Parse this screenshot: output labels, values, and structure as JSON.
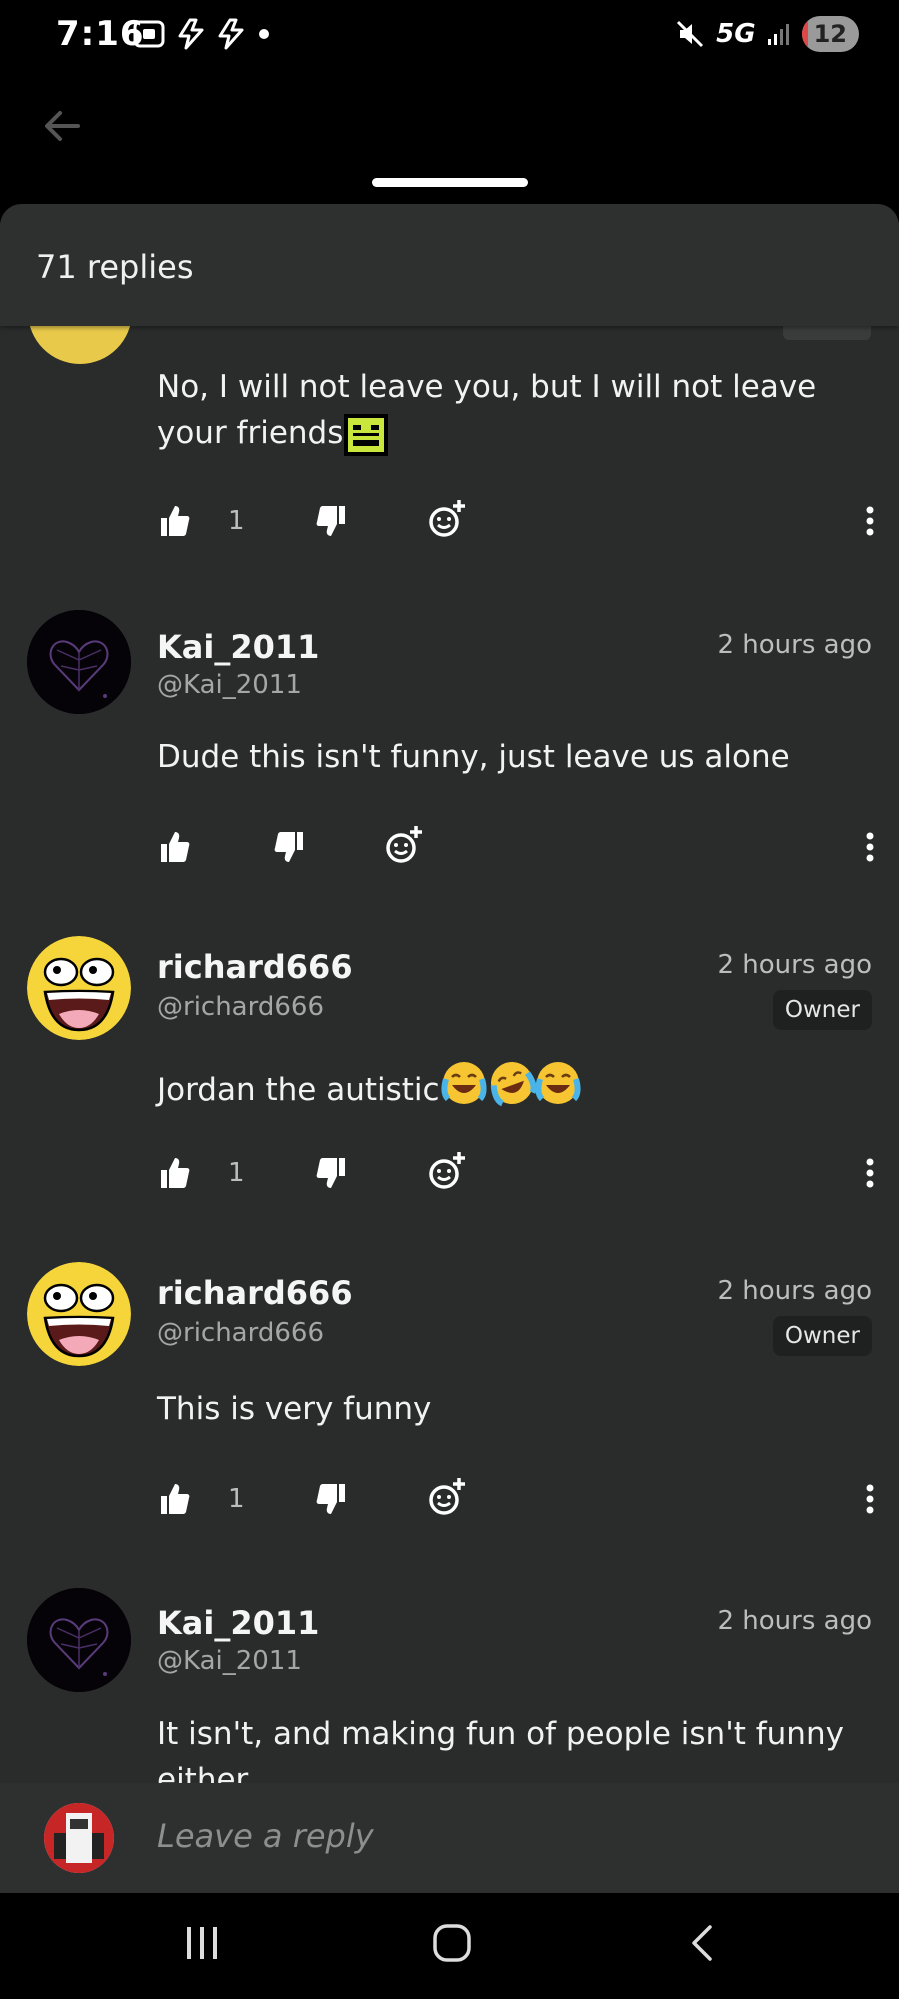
{
  "status_bar": {
    "time": "7:16",
    "battery": "12",
    "battery_level": 0.12,
    "network": "5G",
    "icons": [
      "screenshot-icon",
      "flash-icon",
      "flash-icon",
      "dot-icon",
      "mute-icon",
      "signal-icon"
    ]
  },
  "sheet": {
    "title": "71 replies"
  },
  "comments": [
    {
      "text": "No, I will not leave you, but I will not leave your friends",
      "emoji": "pixel-face-emoji",
      "likes": "1"
    },
    {
      "username": "Kai_2011",
      "handle": "@Kai_2011",
      "time": "2 hours ago",
      "text": "Dude this isn't funny, just leave us alone",
      "avatar": "spiderweb-heart-avatar"
    },
    {
      "username": "richard666",
      "handle": "@richard666",
      "time": "2 hours ago",
      "badge": "Owner",
      "text": "Jordan the autistic",
      "emoji": "laughing-emojis",
      "likes": "1",
      "avatar": "awesome-face-avatar"
    },
    {
      "username": "richard666",
      "handle": "@richard666",
      "time": "2 hours ago",
      "badge": "Owner",
      "text": "This is very funny",
      "likes": "1",
      "avatar": "awesome-face-avatar"
    },
    {
      "username": "Kai_2011",
      "handle": "@Kai_2011",
      "time": "2 hours ago",
      "text": "It isn't, and making fun of people isn't funny either",
      "avatar": "spiderweb-heart-avatar"
    }
  ],
  "reply": {
    "placeholder": "Leave a reply"
  },
  "nav": {
    "icons": [
      "recents-icon",
      "home-icon",
      "back-icon"
    ]
  }
}
